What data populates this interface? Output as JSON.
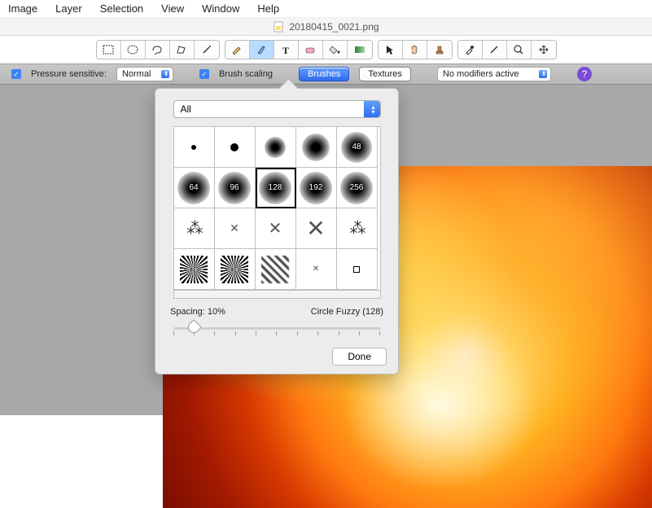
{
  "menubar": {
    "items": [
      "Image",
      "Layer",
      "Selection",
      "View",
      "Window",
      "Help"
    ]
  },
  "document": {
    "filename": "20180415_0021.png"
  },
  "toolbar": {
    "group1": [
      "rect-select",
      "ellipse-select",
      "lasso",
      "polygon-lasso",
      "wand"
    ],
    "group2": [
      "pencil",
      "brush",
      "text",
      "eraser",
      "bucket",
      "gradient"
    ],
    "group3": [
      "pointer",
      "hand",
      "stamp"
    ],
    "group4": [
      "eyedropper",
      "crop",
      "zoom",
      "move"
    ]
  },
  "options": {
    "pressure_label": "Pressure sensitive:",
    "pressure_mode": "Normal",
    "brush_scaling_label": "Brush scaling",
    "brushes_btn": "Brushes",
    "textures_btn": "Textures",
    "modifiers_label": "No modifiers active",
    "help": "?"
  },
  "popover": {
    "filter": "All",
    "brushes": [
      {
        "type": "dot",
        "label": ""
      },
      {
        "type": "dot2",
        "label": ""
      },
      {
        "type": "fuzzy",
        "label": "",
        "size": 26
      },
      {
        "type": "fuzzy",
        "label": "",
        "size": 34
      },
      {
        "type": "fuzzy",
        "label": "48",
        "size": 38
      },
      {
        "type": "fuzzy",
        "label": "64",
        "size": 40
      },
      {
        "type": "fuzzy",
        "label": "96",
        "size": 40
      },
      {
        "type": "fuzzy",
        "label": "128",
        "size": 40,
        "selected": true
      },
      {
        "type": "fuzzy",
        "label": "192",
        "size": 40
      },
      {
        "type": "fuzzy",
        "label": "256",
        "size": 40
      },
      {
        "type": "scatter",
        "label": ""
      },
      {
        "type": "x",
        "label": "",
        "size": 14
      },
      {
        "type": "x",
        "label": "",
        "size": 20
      },
      {
        "type": "x",
        "label": "",
        "size": 28
      },
      {
        "type": "scatter",
        "label": ""
      },
      {
        "type": "noise",
        "label": ""
      },
      {
        "type": "noise",
        "label": ""
      },
      {
        "type": "stripes",
        "label": ""
      },
      {
        "type": "x",
        "label": "",
        "size": 10
      },
      {
        "type": "square",
        "label": ""
      }
    ],
    "spacing_label": "Spacing: 10%",
    "selected_label": "Circle Fuzzy (128)",
    "done": "Done"
  }
}
